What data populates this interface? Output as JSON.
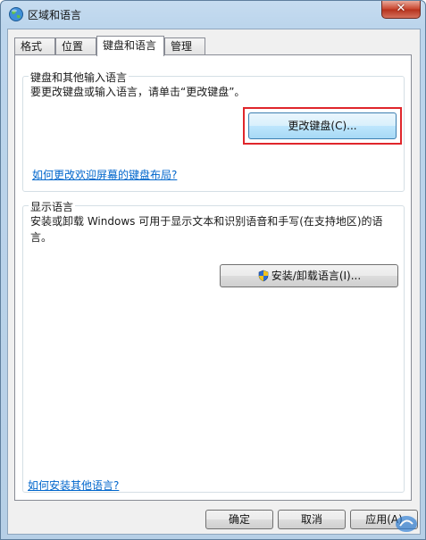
{
  "window": {
    "title": "区域和语言",
    "close_glyph": "✕"
  },
  "tabs": [
    {
      "label": "格式"
    },
    {
      "label": "位置"
    },
    {
      "label": "键盘和语言",
      "active": true
    },
    {
      "label": "管理"
    }
  ],
  "keyboard_group": {
    "title": "键盘和其他输入语言",
    "description": "要更改键盘或输入语言，请单击“更改键盘”。",
    "change_keyboard_button": "更改键盘(C)...",
    "welcome_screen_link": "如何更改欢迎屏幕的键盘布局?"
  },
  "display_group": {
    "title": "显示语言",
    "description": "安装或卸载 Windows 可用于显示文本和识别语音和手写(在支持地区)的语言。",
    "install_button": "安装/卸载语言(I)..."
  },
  "install_other_link": "如何安装其他语言?",
  "footer": {
    "ok": "确定",
    "cancel": "取消",
    "apply": "应用(A)"
  },
  "colors": {
    "highlight": "#e0262b",
    "link": "#0066cc"
  }
}
